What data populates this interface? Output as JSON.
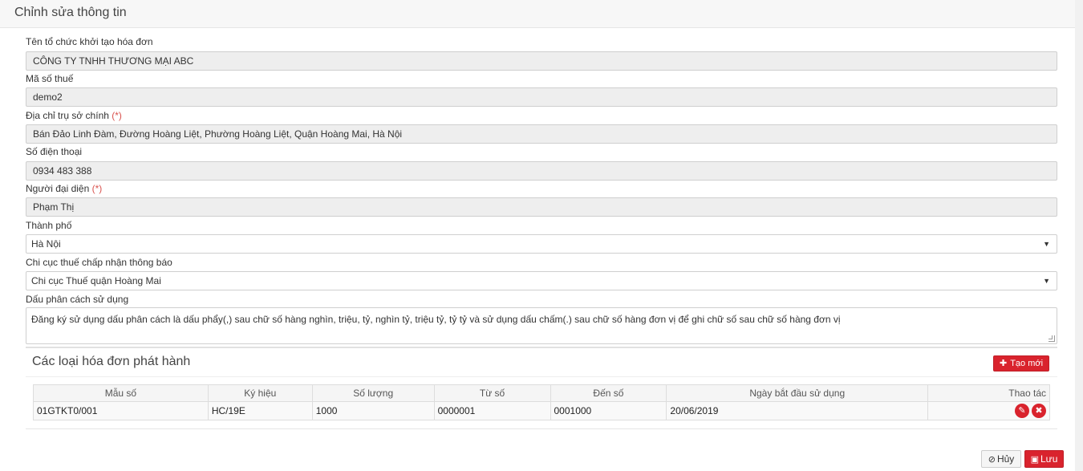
{
  "header": {
    "title": "Chỉnh sửa thông tin"
  },
  "form": {
    "org_name": {
      "label": "Tên tổ chức khởi tạo hóa đơn",
      "value": "CÔNG TY TNHH THƯƠNG MẠI ABC"
    },
    "tax_code": {
      "label": "Mã số thuế",
      "value": "demo2"
    },
    "address": {
      "label": "Địa chỉ trụ sở chính",
      "required_mark": "(*)",
      "value": "Bán Đảo Linh Đàm, Đường Hoàng Liệt, Phường Hoàng Liệt, Quận Hoàng Mai, Hà Nội"
    },
    "phone": {
      "label": "Số điện thoại",
      "value": "0934 483 388"
    },
    "representative": {
      "label": "Người đại diện",
      "required_mark": "(*)",
      "value": "Phạm Thị"
    },
    "city": {
      "label": "Thành phố",
      "value": "Hà Nội"
    },
    "tax_office": {
      "label": "Chi cục thuế chấp nhận thông báo",
      "value": "Chi cục Thuế quận Hoàng Mai"
    },
    "separator": {
      "label": "Dấu phân cách sử dụng",
      "value": "Đăng ký sử dụng dấu phân cách là dấu phẩy(,) sau chữ số hàng nghìn, triệu, tỷ, nghìn tỷ, triệu tỷ, tỷ tỷ và sử dụng dấu chấm(.) sau chữ số hàng đơn vị để ghi chữ số sau chữ số hàng đơn vị"
    }
  },
  "invoices": {
    "title": "Các loại hóa đơn phát hành",
    "create_label": "Tạo mới",
    "columns": [
      "Mẫu số",
      "Ký hiệu",
      "Số lượng",
      "Từ số",
      "Đến số",
      "Ngày bắt đầu sử dụng",
      "Thao tác"
    ],
    "rows": [
      [
        "01GTKT0/001",
        "HC/19E",
        "1000",
        "0000001",
        "0001000",
        "20/06/2019"
      ]
    ]
  },
  "footer": {
    "cancel_label": "Hủy",
    "save_label": "Lưu"
  },
  "colors": {
    "accent": "#d9232d",
    "required": "#d9534f"
  },
  "icons": {
    "create": "plus-icon",
    "edit": "pencil-icon",
    "delete": "close-icon",
    "cancel": "ban-icon",
    "save": "floppy-icon",
    "select": "triangle-down-icon"
  }
}
